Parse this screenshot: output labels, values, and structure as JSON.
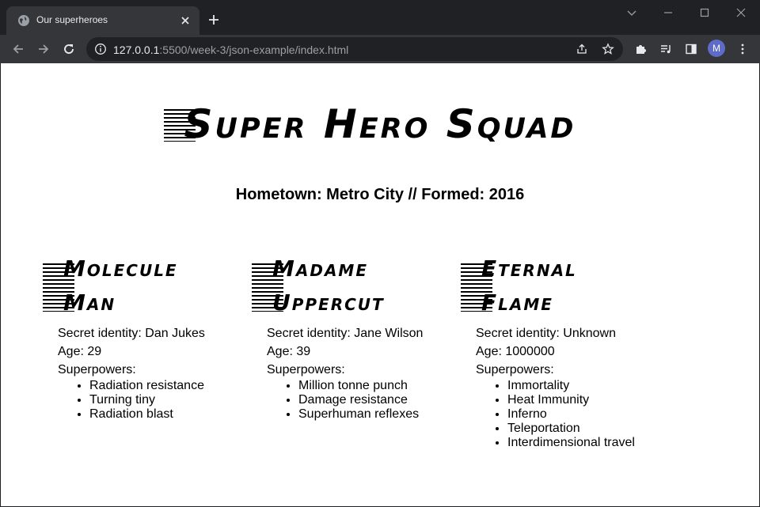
{
  "browser": {
    "tab_title": "Our superheroes",
    "url_host": "127.0.0.1",
    "url_rest": ":5500/week-3/json-example/index.html",
    "avatar_initial": "M"
  },
  "page": {
    "squad_name": "Super Hero Squad",
    "hometown_line": "Hometown: Metro City // Formed: 2016",
    "members": [
      {
        "name": "Molecule Man",
        "identity": "Secret identity: Dan Jukes",
        "age": "Age: 29",
        "powers_label": "Superpowers:",
        "powers": [
          "Radiation resistance",
          "Turning tiny",
          "Radiation blast"
        ]
      },
      {
        "name": "Madame Uppercut",
        "identity": "Secret identity: Jane Wilson",
        "age": "Age: 39",
        "powers_label": "Superpowers:",
        "powers": [
          "Million tonne punch",
          "Damage resistance",
          "Superhuman reflexes"
        ]
      },
      {
        "name": "Eternal Flame",
        "identity": "Secret identity: Unknown",
        "age": "Age: 1000000",
        "powers_label": "Superpowers:",
        "powers": [
          "Immortality",
          "Heat Immunity",
          "Inferno",
          "Teleportation",
          "Interdimensional travel"
        ]
      }
    ]
  },
  "icons": {
    "favicon": "globe-icon",
    "tab_close": "close-icon",
    "new_tab": "plus-icon",
    "back": "back-arrow-icon",
    "forward": "forward-arrow-icon",
    "reload": "reload-icon",
    "site_info": "info-icon",
    "share": "share-icon",
    "bookmark": "star-icon",
    "extensions": "puzzle-icon",
    "media": "media-queue-icon",
    "side_panel": "side-panel-icon",
    "menu": "kebab-menu-icon"
  },
  "colors": {
    "chrome_dark": "#202124",
    "chrome_toolbar": "#35363a",
    "page_background": "#ffffff",
    "text": "#000000",
    "avatar": "#5f6bc9"
  }
}
